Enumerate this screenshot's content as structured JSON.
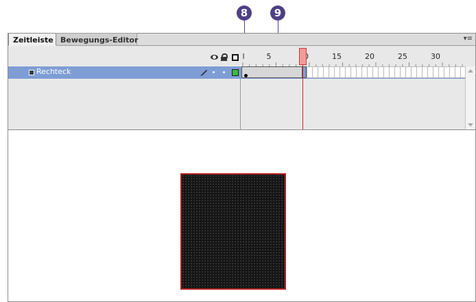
{
  "callouts": {
    "first": "8",
    "second": "9"
  },
  "tabs": {
    "active": "Zeitleiste",
    "inactive": "Bewegungs-Editor"
  },
  "panel_menu_icon": "panel-menu-icon",
  "header_icons": [
    "eye-icon",
    "lock-icon",
    "outline-icon"
  ],
  "ruler": {
    "first_marker": "l",
    "labels": [
      "5",
      "10",
      "15",
      "20",
      "25",
      "30"
    ]
  },
  "layer": {
    "name": "Rechteck"
  },
  "colors": {
    "layer_selected": "#7e9dd4",
    "playhead": "#d8262a",
    "callout": "#4f3f86",
    "shape_fill": "#141414",
    "shape_stroke": "#b02020",
    "outline_color": "#3dbb3d"
  }
}
